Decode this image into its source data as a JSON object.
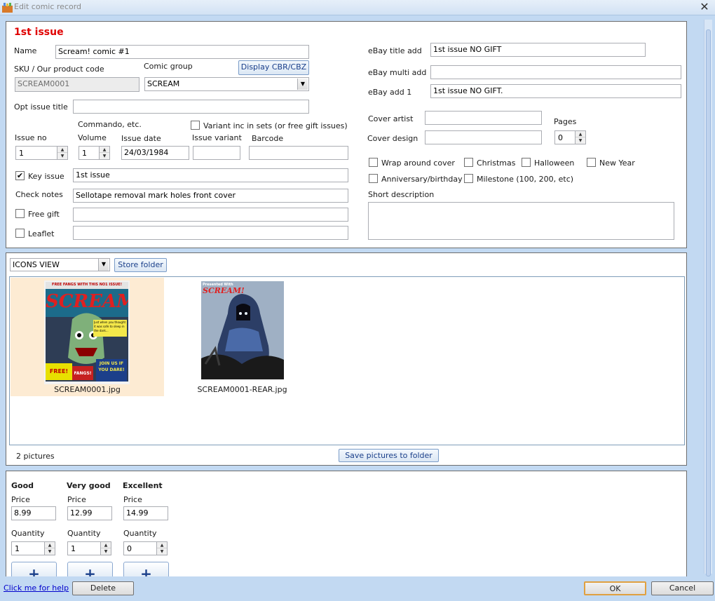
{
  "window": {
    "title": "Edit comic record",
    "close": "✕"
  },
  "record": {
    "heading": "1st issue",
    "name_label": "Name",
    "name_value": "Scream! comic #1",
    "sku_label": "SKU / Our product code",
    "sku_value": "SCREAM0001",
    "group_label": "Comic group",
    "group_value": "SCREAM",
    "display_btn": "Display CBR/CBZ",
    "opt_title_label": "Opt issue title",
    "opt_title_value": "",
    "commando_label": "Commando, etc.",
    "variant_sets_label": "Variant inc in sets (or free gift issues)",
    "issue_no_label": "Issue no",
    "issue_no_value": "1",
    "volume_label": "Volume",
    "volume_value": "1",
    "issue_date_label": "Issue date",
    "issue_date_value": "24/03/1984",
    "issue_variant_label": "Issue variant",
    "issue_variant_value": "",
    "barcode_label": "Barcode",
    "barcode_value": "",
    "key_issue_label": "Key issue",
    "key_issue_checked": "✔",
    "key_issue_value": "1st issue",
    "check_notes_label": "Check notes",
    "check_notes_value": "Sellotape removal mark holes front cover",
    "free_gift_label": "Free gift",
    "free_gift_value": "",
    "leaflet_label": "Leaflet",
    "leaflet_value": ""
  },
  "ebay": {
    "title_add_label": "eBay title add",
    "title_add_value": "1st issue NO GIFT",
    "multi_add_label": "eBay multi add",
    "multi_add_value": "",
    "add1_label": "eBay add 1",
    "add1_value": "1st issue NO GIFT.",
    "cover_artist_label": "Cover artist",
    "cover_artist_value": "",
    "cover_design_label": "Cover design",
    "cover_design_value": "",
    "pages_label": "Pages",
    "pages_value": "0",
    "wrap_label": "Wrap around cover",
    "christmas_label": "Christmas",
    "halloween_label": "Halloween",
    "new_year_label": "New Year",
    "anniversary_label": "Anniversary/birthday",
    "milestone_label": "Milestone (100, 200, etc)",
    "short_desc_label": "Short description",
    "short_desc_value": ""
  },
  "pictures": {
    "view_value": "ICONS VIEW",
    "store_btn": "Store folder",
    "items": [
      {
        "filename": "SCREAM0001.jpg",
        "cover_top": "FREE FANGS WITH THIS NO1 ISSUE!",
        "cover_logo": "SCREAM!",
        "cover_blurb": "Just when you thought it was safe to sleep in the dark...",
        "cover_free": "FREE!",
        "cover_fangs": "FANGS!",
        "cover_join": "JOIN US IF YOU DARE!"
      },
      {
        "filename": "SCREAM0001-REAR.jpg",
        "cover_top": "Presented With",
        "cover_logo": "SCREAM!"
      }
    ],
    "count": "2 pictures",
    "save_btn": "Save pictures to folder"
  },
  "pricing": [
    {
      "grade": "Good",
      "price_label": "Price",
      "price": "8.99",
      "qty_label": "Quantity",
      "qty": "1",
      "add": "+"
    },
    {
      "grade": "Very good",
      "price_label": "Price",
      "price": "12.99",
      "qty_label": "Quantity",
      "qty": "1",
      "add": "+"
    },
    {
      "grade": "Excellent",
      "price_label": "Price",
      "price": "14.99",
      "qty_label": "Quantity",
      "qty": "0",
      "add": "+"
    }
  ],
  "footer": {
    "help": "Click me for help",
    "delete": "Delete",
    "ok": "OK",
    "cancel": "Cancel"
  },
  "icons": {
    "spin_up": "▲",
    "spin_down": "▼",
    "dropdown": "▼"
  }
}
